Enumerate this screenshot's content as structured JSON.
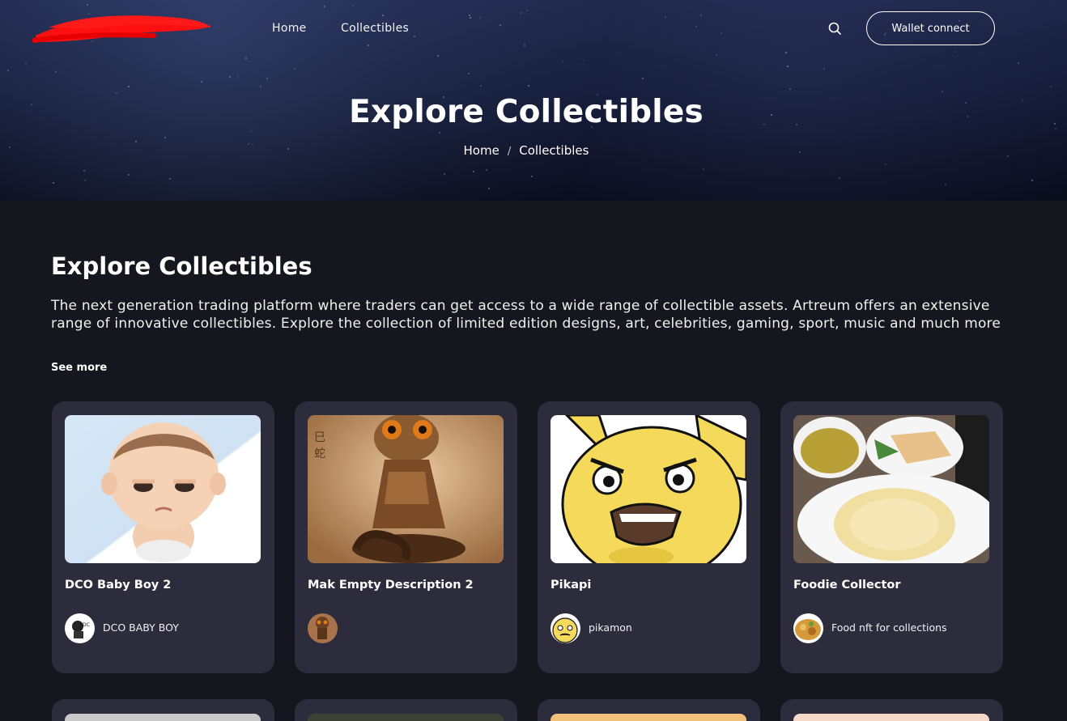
{
  "header": {
    "nav": [
      {
        "label": "Home"
      },
      {
        "label": "Collectibles"
      }
    ],
    "wallet_button": "Wallet connect"
  },
  "hero": {
    "title": "Explore Collectibles",
    "breadcrumb": {
      "home": "Home",
      "separator": "/",
      "current": "Collectibles"
    }
  },
  "main": {
    "title": "Explore Collectibles",
    "description": "The next generation trading platform where traders can get access to a wide range of collectible assets. Artreum offers an extensive range of innovative collectibles. Explore the collection of limited edition designs, art, celebrities, gaming, sport, music and much more",
    "see_more": "See more",
    "cards": [
      {
        "title": "DCO Baby Boy 2",
        "creator": "DCO BABY BOY",
        "image_icon": "baby-cartoon-image",
        "avatar_icon": "dco-logo-avatar"
      },
      {
        "title": "Mak Empty Description 2",
        "creator": "",
        "image_icon": "snake-monk-image",
        "avatar_icon": "snake-avatar"
      },
      {
        "title": "Pikapi",
        "creator": "pikamon",
        "image_icon": "angry-pikachu-image",
        "avatar_icon": "pikachu-avatar"
      },
      {
        "title": "Foodie Collector",
        "creator": "Food nft for collections",
        "image_icon": "chicken-rice-image",
        "avatar_icon": "food-avatar"
      }
    ]
  },
  "colors": {
    "page_bg": "#16161f",
    "card_bg": "#2c2c3d",
    "hero_bg": "#111833",
    "text": "#ffffff"
  }
}
